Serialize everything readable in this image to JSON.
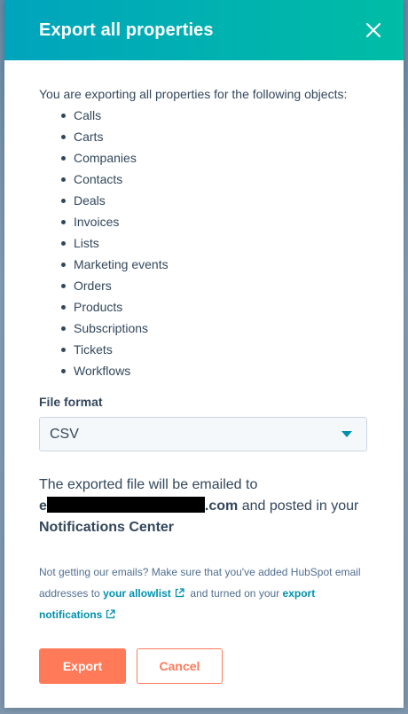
{
  "modal": {
    "title": "Export all properties",
    "close_icon": "close-icon"
  },
  "body": {
    "intro": "You are exporting all properties for the following objects:",
    "objects": [
      "Calls",
      "Carts",
      "Companies",
      "Contacts",
      "Deals",
      "Invoices",
      "Lists",
      "Marketing events",
      "Orders",
      "Products",
      "Subscriptions",
      "Tickets",
      "Workflows"
    ],
    "file_format_label": "File format",
    "file_format_value": "CSV",
    "email_text_1": "The exported file will be emailed to",
    "email_prefix": "e",
    "email_suffix": ".com",
    "email_text_2": "and posted in your",
    "notifications_center": "Notifications Center",
    "help_text_1": "Not getting our emails? Make sure that you've added HubSpot email addresses to",
    "allowlist_link": "your allowlist",
    "help_text_2": "and turned on your",
    "export_notifications_link": "export notifications"
  },
  "actions": {
    "export_label": "Export",
    "cancel_label": "Cancel"
  },
  "colors": {
    "header_start": "#00a4bd",
    "header_end": "#00bda5",
    "primary": "#ff7a59",
    "link": "#0091ae",
    "text": "#33475b"
  }
}
